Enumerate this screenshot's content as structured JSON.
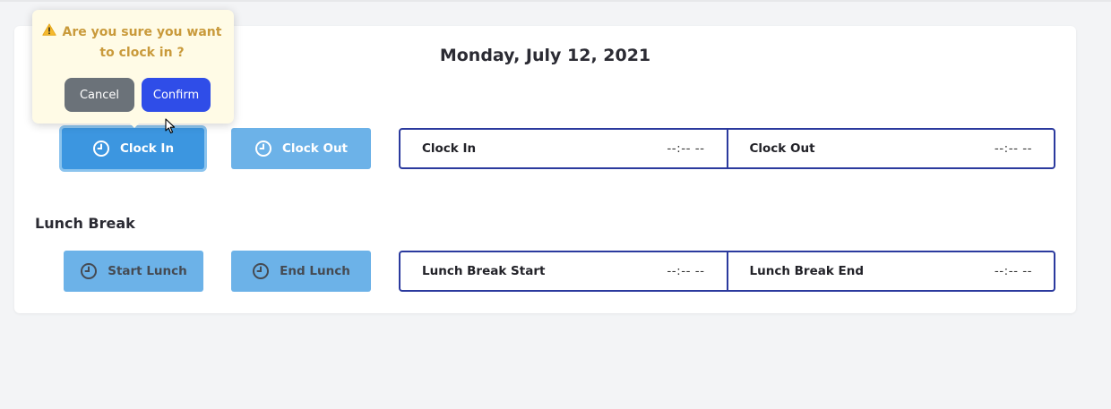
{
  "header": {
    "date": "Monday, July 12, 2021"
  },
  "attendance": {
    "clock_in_button": "Clock In",
    "clock_out_button": "Clock Out",
    "clock_in_label": "Clock In",
    "clock_in_value": "--:-- --",
    "clock_out_label": "Clock Out",
    "clock_out_value": "--:-- --"
  },
  "lunch": {
    "section_title": "Lunch Break",
    "start_button": "Start Lunch",
    "end_button": "End Lunch",
    "start_label": "Lunch Break Start",
    "start_value": "--:-- --",
    "end_label": "Lunch Break End",
    "end_value": "--:-- --"
  },
  "confirm_popover": {
    "message": "Are you sure you want to clock in ?",
    "cancel_label": "Cancel",
    "confirm_label": "Confirm"
  },
  "icons": {
    "button_icon": "clock-icon",
    "popover_icon": "warning-icon"
  },
  "colors": {
    "primary_button": "#6cb2e8",
    "active_button": "#3c96e0",
    "box_border": "#2b3a9e",
    "confirm": "#2f4de8",
    "cancel": "#6b7279",
    "warning_text": "#c99a3b"
  }
}
